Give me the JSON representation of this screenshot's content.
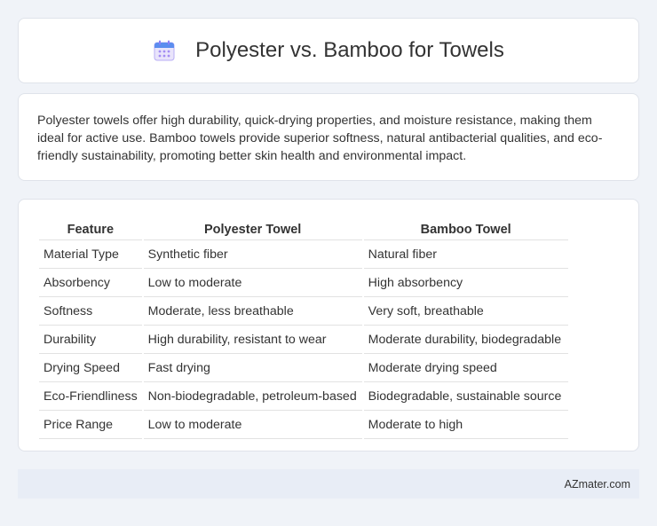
{
  "header": {
    "title": "Polyester vs. Bamboo for Towels",
    "icon": "calendar-icon"
  },
  "summary": {
    "text": "Polyester towels offer high durability, quick-drying properties, and moisture resistance, making them ideal for active use. Bamboo towels provide superior softness, natural antibacterial qualities, and eco-friendly sustainability, promoting better skin health and environmental impact."
  },
  "table": {
    "headers": [
      "Feature",
      "Polyester Towel",
      "Bamboo Towel"
    ],
    "rows": [
      [
        "Material Type",
        "Synthetic fiber",
        "Natural fiber"
      ],
      [
        "Absorbency",
        "Low to moderate",
        "High absorbency"
      ],
      [
        "Softness",
        "Moderate, less breathable",
        "Very soft, breathable"
      ],
      [
        "Durability",
        "High durability, resistant to wear",
        "Moderate durability, biodegradable"
      ],
      [
        "Drying Speed",
        "Fast drying",
        "Moderate drying speed"
      ],
      [
        "Eco-Friendliness",
        "Non-biodegradable, petroleum-based",
        "Biodegradable, sustainable source"
      ],
      [
        "Price Range",
        "Low to moderate",
        "Moderate to high"
      ]
    ]
  },
  "footer": {
    "brand": "AZmater.com"
  },
  "colors": {
    "background": "#f0f3f8",
    "card": "#ffffff",
    "footer": "#e8edf6",
    "icon_purple": "#8b7cf6",
    "icon_blue": "#5b8def"
  }
}
